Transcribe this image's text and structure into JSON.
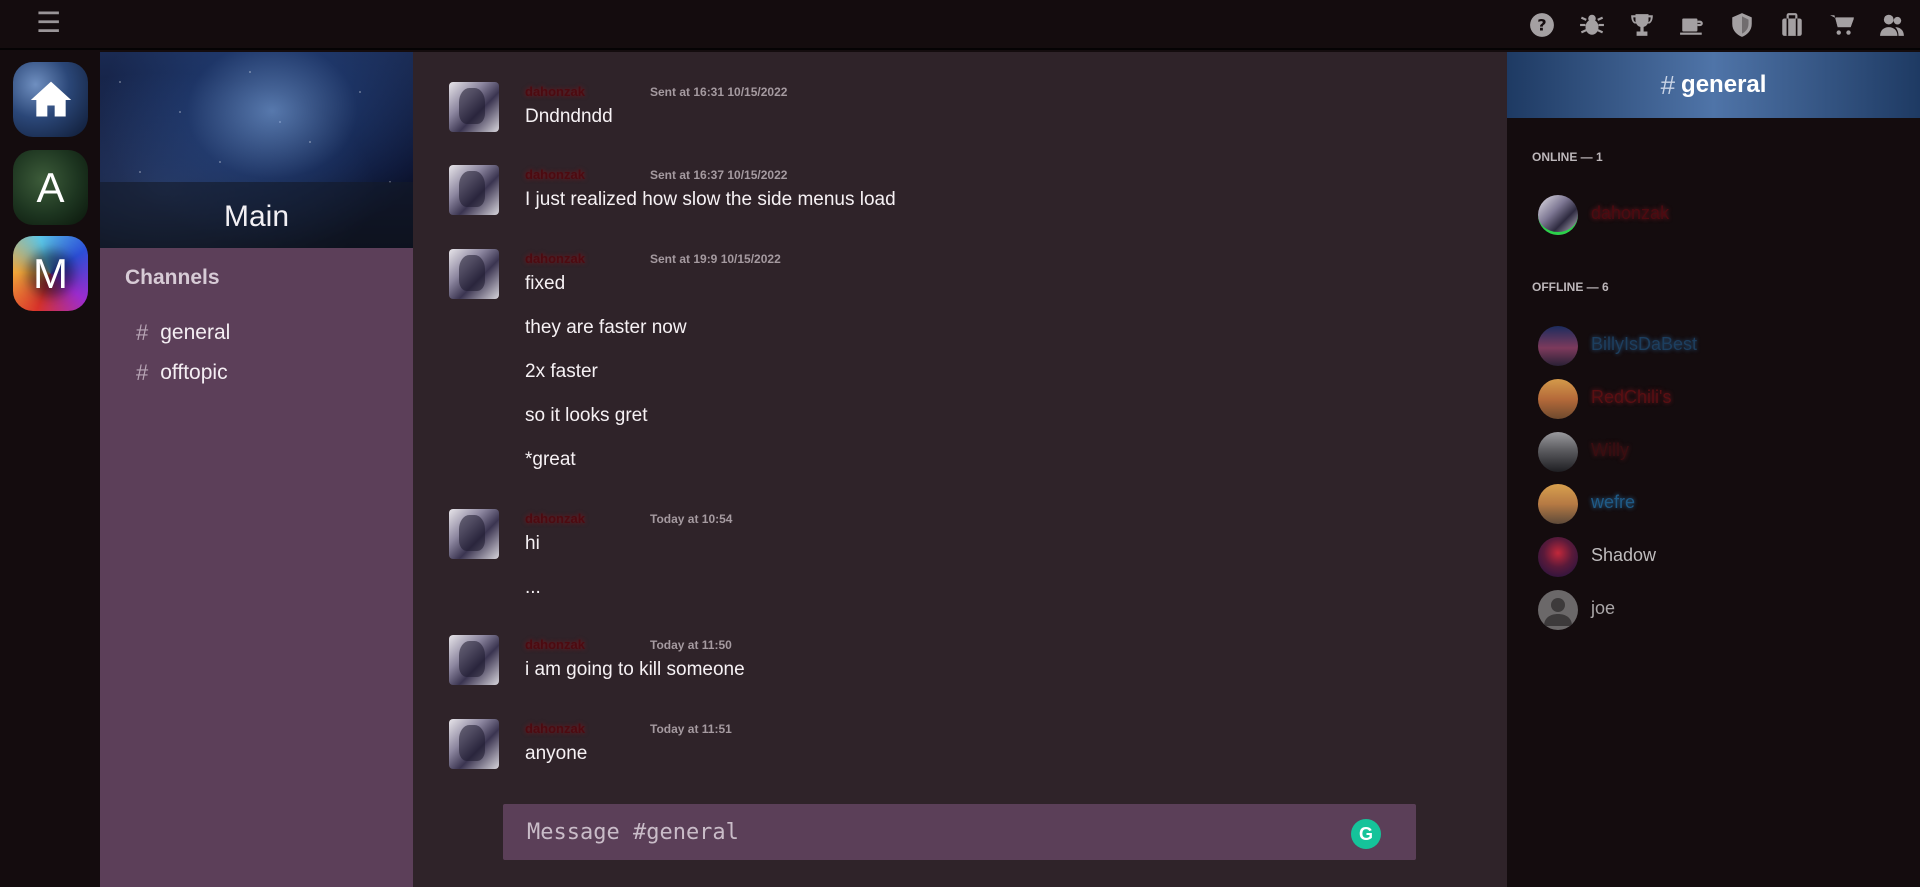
{
  "topbar": {
    "menu_icon": "hamburger-icon",
    "icons": [
      "help-icon",
      "bug-icon",
      "trophy-icon",
      "coffee-icon",
      "shield-icon",
      "briefcase-icon",
      "cart-icon",
      "users-icon"
    ]
  },
  "servers": [
    {
      "name": "home",
      "label": ""
    },
    {
      "name": "A",
      "label": "A"
    },
    {
      "name": "M",
      "label": "M"
    }
  ],
  "server": {
    "name": "Main",
    "channels_heading": "Channels",
    "channels": [
      {
        "hash": "#",
        "name": "general"
      },
      {
        "hash": "#",
        "name": "offtopic"
      }
    ]
  },
  "messages": [
    {
      "user": "dahonzak",
      "time": "Sent at 16:31 10/15/2022",
      "lines": [
        "Dndndndd"
      ]
    },
    {
      "user": "dahonzak",
      "time": "Sent at 16:37 10/15/2022",
      "lines": [
        "I just realized how slow the side menus load"
      ]
    },
    {
      "user": "dahonzak",
      "time": "Sent at 19:9 10/15/2022",
      "lines": [
        "fixed",
        "they are faster now",
        "2x faster",
        "so it looks gret",
        "*great"
      ]
    },
    {
      "user": "dahonzak",
      "time": "Today at 10:54",
      "lines": [
        "hi",
        "..."
      ]
    },
    {
      "user": "dahonzak",
      "time": "Today at 11:50",
      "lines": [
        "i am going to kill someone"
      ]
    },
    {
      "user": "dahonzak",
      "time": "Today at 11:51",
      "lines": [
        "anyone"
      ]
    }
  ],
  "composer": {
    "placeholder": "Message #general",
    "grammarly_icon": "grammarly-icon"
  },
  "member_panel": {
    "hash": "#",
    "title": "general",
    "online_label": "ONLINE — 1",
    "offline_label": "OFFLINE — 6",
    "online": [
      {
        "name": "dahonzak",
        "color": "#4d0a10"
      }
    ],
    "offline": [
      {
        "name": "BillyIsDaBest",
        "color": "#1d3e5e"
      },
      {
        "name": "RedChili's",
        "color": "#5a0f12"
      },
      {
        "name": "Willy",
        "color": "#3a0d10"
      },
      {
        "name": "wefre",
        "color": "#1f5a86"
      },
      {
        "name": "Shadow",
        "color": "#bfbcbd"
      },
      {
        "name": "joe",
        "color": "#a9a6a7"
      }
    ]
  }
}
